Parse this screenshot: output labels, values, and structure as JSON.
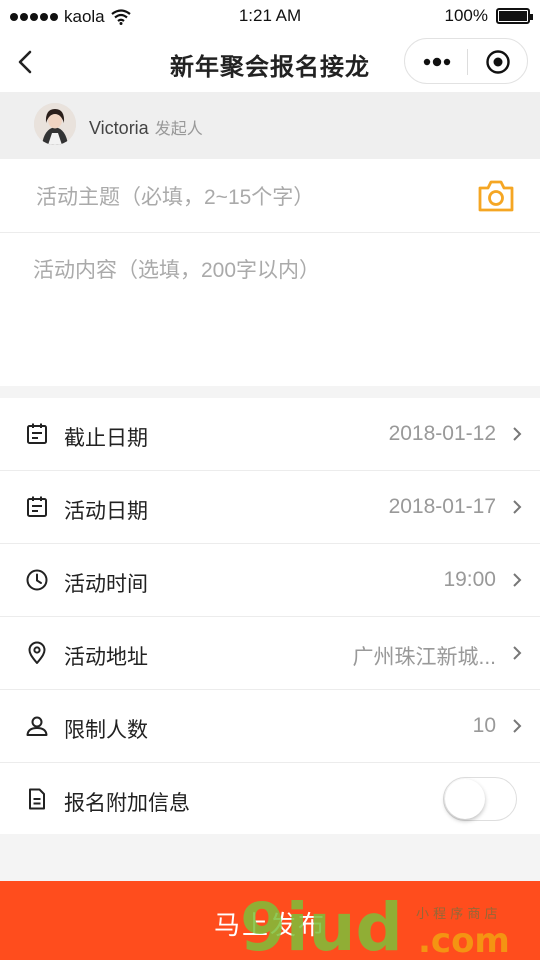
{
  "status_bar": {
    "carrier": "kaola",
    "time": "1:21 AM",
    "battery": "100%"
  },
  "nav": {
    "title": "新年聚会报名接龙"
  },
  "initiator": {
    "name": "Victoria",
    "role": "发起人"
  },
  "form": {
    "topic_placeholder": "活动主题（必填，2~15个字）",
    "content_placeholder": "活动内容（选填，200字以内）"
  },
  "rows": [
    {
      "icon": "calendar-icon",
      "label": "截止日期",
      "value": "2018-01-12"
    },
    {
      "icon": "calendar-icon",
      "label": "活动日期",
      "value": "2018-01-17"
    },
    {
      "icon": "clock-icon",
      "label": "活动时间",
      "value": "19:00"
    },
    {
      "icon": "location-pin-icon",
      "label": "活动地址",
      "value": "广州珠江新城..."
    },
    {
      "icon": "people-icon",
      "label": "限制人数",
      "value": "10"
    },
    {
      "icon": "document-icon",
      "label": "报名附加信息",
      "toggle_on": false
    }
  ],
  "publish_label": "马上发布",
  "colors": {
    "accent": "#ff4d1d",
    "camera_icon": "#f5a623"
  },
  "watermark": {
    "text_1": "9iud",
    "text_2": ".com",
    "text_3": "小 程 序 商 店"
  }
}
